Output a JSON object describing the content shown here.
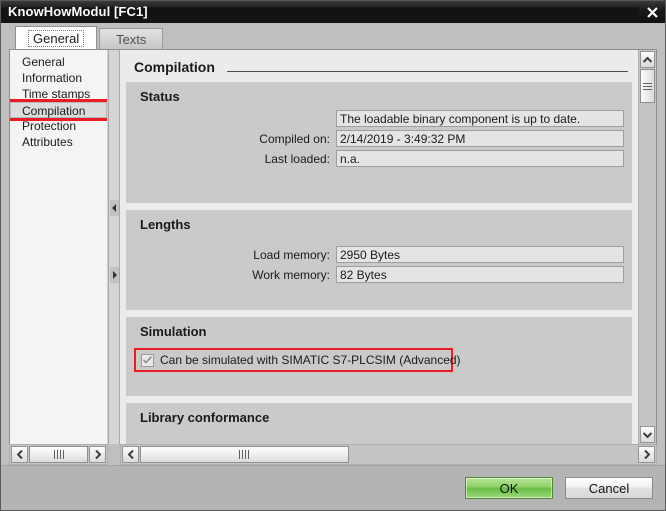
{
  "window": {
    "title": "KnowHowModul [FC1]",
    "close_icon": "close-icon"
  },
  "tabs": [
    {
      "label": "General",
      "active": true
    },
    {
      "label": "Texts",
      "active": false
    }
  ],
  "sidebar": {
    "items": [
      {
        "label": "General",
        "selected": false
      },
      {
        "label": "Information",
        "selected": false
      },
      {
        "label": "Time stamps",
        "selected": false
      },
      {
        "label": "Compilation",
        "selected": true
      },
      {
        "label": "Protection",
        "selected": false
      },
      {
        "label": "Attributes",
        "selected": false
      }
    ]
  },
  "content": {
    "page_title": "Compilation",
    "sections": {
      "status": {
        "title": "Status",
        "message_value": "The loadable binary component is up to date.",
        "compiled_on_label": "Compiled on:",
        "compiled_on_value": "2/14/2019 - 3:49:32 PM",
        "last_loaded_label": "Last loaded:",
        "last_loaded_value": "n.a."
      },
      "lengths": {
        "title": "Lengths",
        "load_memory_label": "Load memory:",
        "load_memory_value": "2950 Bytes",
        "work_memory_label": "Work memory:",
        "work_memory_value": "82 Bytes"
      },
      "simulation": {
        "title": "Simulation",
        "checkbox_label": "Can be simulated with SIMATIC S7-PLCSIM (Advanced)",
        "checkbox_checked": true,
        "highlight_color": "#ec1c24"
      },
      "library": {
        "title": "Library conformance"
      }
    }
  },
  "footer": {
    "ok_label": "OK",
    "cancel_label": "Cancel",
    "ok_color": "#69bd45"
  },
  "scrollbars": {
    "up_icon": "chevron-up-icon",
    "down_icon": "chevron-down-icon",
    "left_icon": "chevron-left-icon",
    "right_icon": "chevron-right-icon"
  },
  "splitter": {
    "collapse_left_icon": "triangle-left-icon",
    "collapse_right_icon": "triangle-right-icon"
  }
}
